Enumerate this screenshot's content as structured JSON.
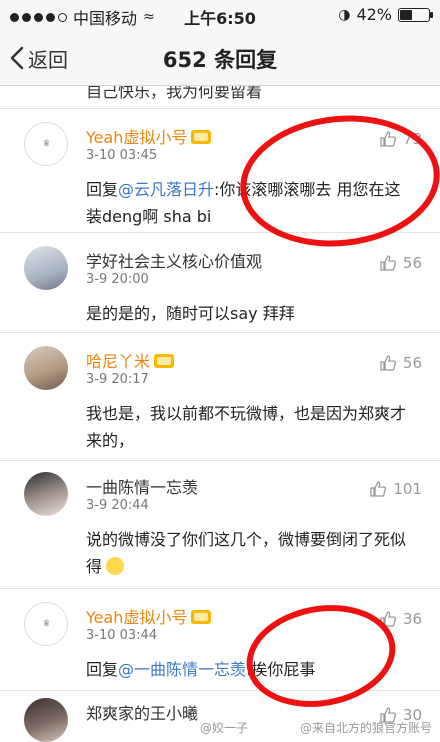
{
  "status_bar": {
    "carrier": "中国移动",
    "time": "上午6:50",
    "battery": "42%",
    "battery_level": 0.42
  },
  "nav": {
    "back_label": "返回",
    "title": "652 条回复"
  },
  "partial_text": "自己快乐，我为何要留着",
  "comments": [
    {
      "name": "Yeah虚拟小号",
      "date": "3-10 03:45",
      "reply_prefix": "回复",
      "mention": "@云凡落日升",
      "text": ":你该滚哪滚哪去 用您在这装deng啊 sha bi",
      "likes": "73"
    },
    {
      "name": "学好社会主义核心价值观",
      "date": "3-9 20:00",
      "text": "是的是的，随时可以say 拜拜",
      "likes": "56"
    },
    {
      "name": "哈尼丫米",
      "date": "3-9 20:17",
      "text": "我也是，我以前都不玩微博，也是因为郑爽才来的，",
      "likes": "56"
    },
    {
      "name": "一曲陈情一忘羡",
      "date": "3-9 20:44",
      "text": "说的微博没了你们这几个，微博要倒闭了死似得",
      "likes": "101"
    },
    {
      "name": "Yeah虚拟小号",
      "date": "3-10 03:44",
      "reply_prefix": "回复",
      "mention": "@一曲陈情一忘羡",
      "text": ":挨你屁事",
      "likes": "36"
    },
    {
      "name": "郑爽家的王小曦",
      "likes": "30"
    }
  ],
  "watermarks": {
    "left": "@姣一子",
    "right": "@来自北方的狼官方账号"
  },
  "colors": {
    "vip_name": "#e8870e",
    "mention": "#3a78c9",
    "annotation_circle": "#ee1111"
  }
}
